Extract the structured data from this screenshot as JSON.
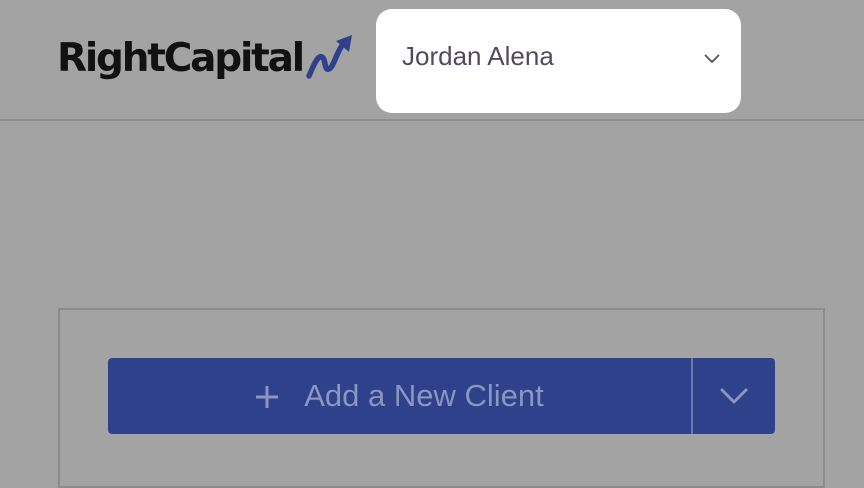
{
  "brand": {
    "name": "RightCapital",
    "text_color": "#111111",
    "mark_color": "#2f418a"
  },
  "client_selector": {
    "selected_client": "Jordan Alena",
    "icon": "chevron-down-icon",
    "text_color": "#524b5e"
  },
  "actions": {
    "add_client_label": "Add a New Client",
    "add_icon": "plus-icon",
    "menu_icon": "chevron-down-icon",
    "button_color": "#2f418a"
  },
  "colors": {
    "overlay": "#a3a3a3"
  }
}
